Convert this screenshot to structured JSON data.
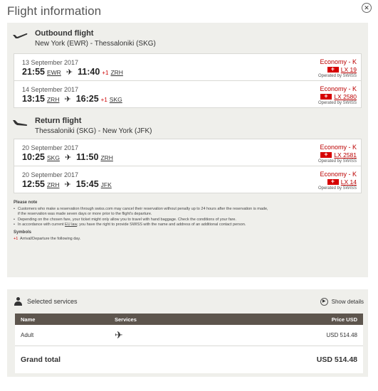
{
  "header": {
    "title": "Flight information",
    "close_icon": "close-icon"
  },
  "outbound": {
    "title": "Outbound flight",
    "route": "New York (EWR) - Thessaloniki (SKG)",
    "segments": [
      {
        "date": "13 September 2017",
        "dep_time": "21:55",
        "dep_code": "EWR",
        "arr_time": "11:40",
        "plus": "+1",
        "arr_code": "ZRH",
        "cabin": "Economy - K",
        "flight_no": "LX 19",
        "operator": "Operated by SWISS"
      },
      {
        "date": "14 September 2017",
        "dep_time": "13:15",
        "dep_code": "ZRH",
        "arr_time": "16:25",
        "plus": "+1",
        "arr_code": "SKG",
        "cabin": "Economy - K",
        "flight_no": "LX 2580",
        "operator": "Operated by SWISS"
      }
    ]
  },
  "return": {
    "title": "Return flight",
    "route": "Thessaloniki (SKG) - New York (JFK)",
    "segments": [
      {
        "date": "20 September 2017",
        "dep_time": "10:25",
        "dep_code": "SKG",
        "arr_time": "11:50",
        "plus": "",
        "arr_code": "ZRH",
        "cabin": "Economy - K",
        "flight_no": "LX 2581",
        "operator": "Operated by SWISS"
      },
      {
        "date": "20 September 2017",
        "dep_time": "12:55",
        "dep_code": "ZRH",
        "arr_time": "15:45",
        "plus": "",
        "arr_code": "JFK",
        "cabin": "Economy - K",
        "flight_no": "LX 14",
        "operator": "Operated by SWISS"
      }
    ]
  },
  "note": {
    "heading": "Please note",
    "item1": "Customers who make a reservation through swiss.com may cancel their reservation without penalty up to 24 hours after the reservation is made, if the reservation was made seven days or more prior to the flight's departure.",
    "item2": "Depending on the chosen fare, your ticket might only allow you to travel with hand baggage. Check the conditions of your fare.",
    "item3_pre": "In accordance with current ",
    "item3_link": "EU law",
    "item3_post": ", you have the right to provide SWISS with the name and address of an additional contact person.",
    "symbols_heading": "Symbols",
    "symbol_code": "+1",
    "symbol_text": "Arrival/Departure the following day."
  },
  "services": {
    "title": "Selected services",
    "show_details": "Show details",
    "col_name": "Name",
    "col_services": "Services",
    "col_price": "Price USD",
    "row_name": "Adult",
    "row_service_icon": "plane-icon",
    "row_price": "USD 514.48",
    "grand_total_label": "Grand total",
    "grand_total_value": "USD 514.48"
  },
  "colors": {
    "accent_red": "#cc0000",
    "panel_bg": "#efefeb",
    "table_header": "#5d554d"
  }
}
